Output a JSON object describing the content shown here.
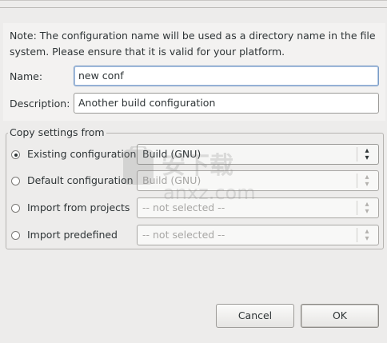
{
  "note": {
    "line1": "Note: The configuration name will be used as a directory name in the file",
    "line2": "system.  Please ensure that it is valid for your platform."
  },
  "name": {
    "label": "Name:",
    "value": "new conf"
  },
  "description": {
    "label": "Description:",
    "value": "Another build configuration"
  },
  "copy_settings": {
    "legend": "Copy settings from",
    "options": [
      {
        "label": "Existing configuration",
        "selected": true,
        "combo": "Build (GNU)",
        "enabled": true
      },
      {
        "label": "Default configuration",
        "selected": false,
        "combo": "Build (GNU)",
        "enabled": false
      },
      {
        "label": "Import from projects",
        "selected": false,
        "combo": "-- not selected --",
        "enabled": false
      },
      {
        "label": "Import predefined",
        "selected": false,
        "combo": "-- not selected --",
        "enabled": false
      }
    ]
  },
  "buttons": {
    "cancel": "Cancel",
    "ok": "OK"
  },
  "watermark": {
    "text": "anxz.com",
    "cn": "安下载"
  },
  "icons": {
    "combo_arrows": "up-down-chevron-icon"
  }
}
